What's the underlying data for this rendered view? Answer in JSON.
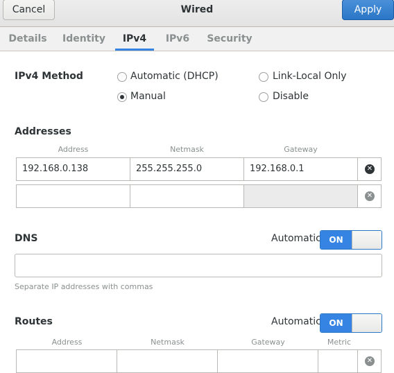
{
  "header": {
    "cancel_label": "Cancel",
    "title": "Wired",
    "apply_label": "Apply"
  },
  "tabs": [
    "Details",
    "Identity",
    "IPv4",
    "IPv6",
    "Security"
  ],
  "active_tab": "IPv4",
  "ipv4": {
    "method_label": "IPv4 Method",
    "methods": {
      "automatic_dhcp": "Automatic (DHCP)",
      "link_local_only": "Link-Local Only",
      "manual": "Manual",
      "disable": "Disable"
    },
    "selected_method": "Manual"
  },
  "addresses": {
    "heading": "Addresses",
    "columns": [
      "Address",
      "Netmask",
      "Gateway"
    ],
    "rows": [
      {
        "address": "192.168.0.138",
        "netmask": "255.255.255.0",
        "gateway": "192.168.0.1"
      },
      {
        "address": "",
        "netmask": "",
        "gateway": ""
      }
    ]
  },
  "dns": {
    "heading": "DNS",
    "automatic_label": "Automatic",
    "switch_label": "ON",
    "value": "",
    "hint": "Separate IP addresses with commas"
  },
  "routes": {
    "heading": "Routes",
    "automatic_label": "Automatic",
    "switch_label": "ON",
    "columns": [
      "Address",
      "Netmask",
      "Gateway",
      "Metric"
    ]
  },
  "colors": {
    "accent": "#3584e4",
    "apply_button": "#2a76c6"
  }
}
